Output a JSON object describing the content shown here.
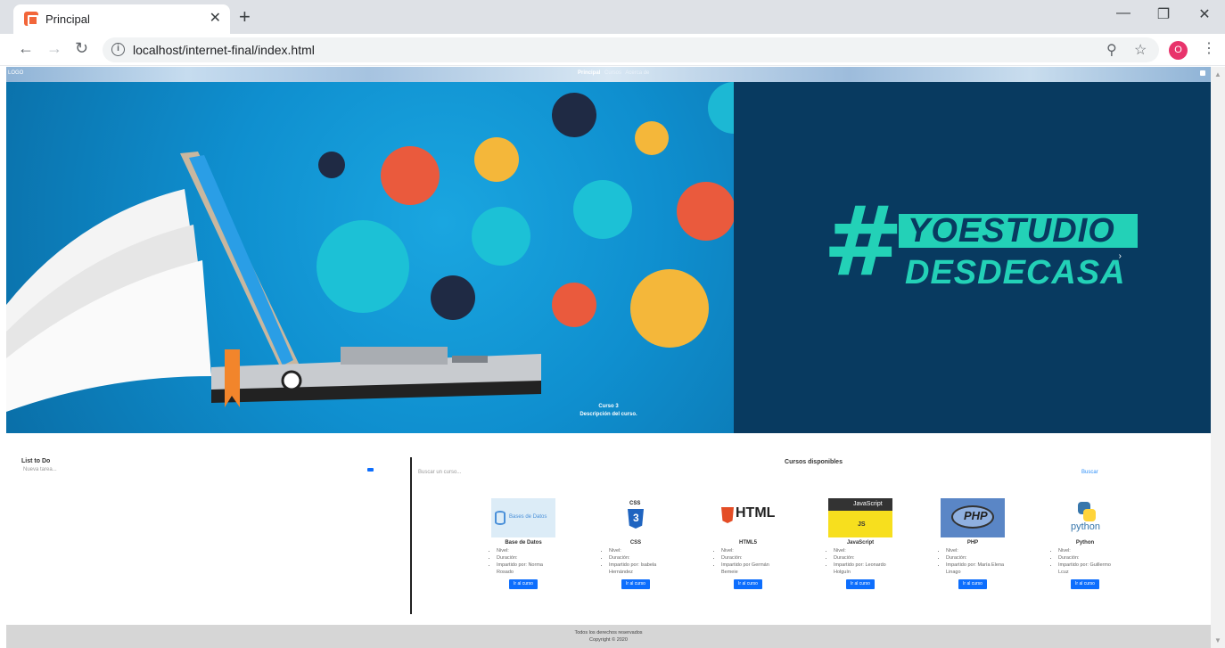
{
  "browser": {
    "tab_title": "Principal",
    "tab_close": "✕",
    "new_tab": "+",
    "url": "localhost/internet-final/index.html",
    "profile_initial": "O",
    "minimize": "—",
    "restore": "❐",
    "close": "✕"
  },
  "site": {
    "logo": "LOGO",
    "nav": [
      "Principal",
      "Cursos",
      "Acerca de"
    ],
    "hero": {
      "hashtag": "#",
      "line1": "YOESTUDIO",
      "line2": "DESDECASA",
      "caption_title": "Curso 3",
      "caption_desc": "Descripción del curso.",
      "next_arrow": "›"
    },
    "todo": {
      "title": "List to Do",
      "placeholder": "Nueva tarea..."
    },
    "courses": {
      "title": "Cursos disponibles",
      "search_placeholder": "Buscar un curso...",
      "search_button": "Buscar",
      "button_label": "Ir al curso",
      "items": [
        {
          "name": "Base de Datos",
          "image_text": "Bases de Datos",
          "nivel": "Nivel:",
          "duracion": "Duración:",
          "impartido": "Impartido por: Norma Rosado"
        },
        {
          "name": "CSS",
          "image_text": "CSS",
          "nivel": "Nivel:",
          "duracion": "Duración:",
          "impartido": "Impartido por: Isabela Hernández"
        },
        {
          "name": "HTML5",
          "image_text": "HTML",
          "nivel": "Nivel:",
          "duracion": "Duración:",
          "impartido": "Impartido por Germán Bemeie"
        },
        {
          "name": "JavaScript",
          "image_text": "JavaScript",
          "nivel": "Nivel:",
          "duracion": "Duración:",
          "impartido": "Impartido por: Leonardo Holguín"
        },
        {
          "name": "PHP",
          "image_text": "PHP",
          "nivel": "Nivel:",
          "duracion": "Duración:",
          "impartido": "Impartido por: María Elena Linago"
        },
        {
          "name": "Python",
          "image_text": "python",
          "nivel": "Nivel:",
          "duracion": "Duración:",
          "impartido": "Impartido por: Guillermo Lcuz"
        }
      ]
    },
    "footer": {
      "line1": "Todos los derechos reservados",
      "line2": "Copyright © 2020"
    }
  }
}
